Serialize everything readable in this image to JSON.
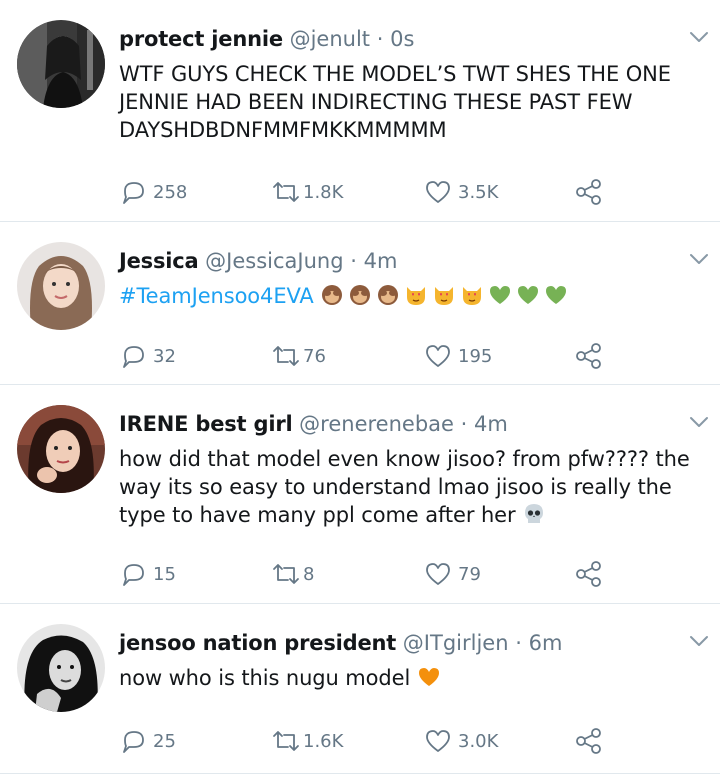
{
  "tweets": [
    {
      "name": "protect jennie",
      "handle": "@jenult",
      "dot": "·",
      "time": "0s",
      "text": "WTF GUYS CHECK THE MODEL’S TWT SHES THE ONE JENNIE HAD BEEN INDIRECTING THESE PAST FEW DAYSHDBDNFMMFMKKMMMMM",
      "replies": "258",
      "retweets": "1.8K",
      "likes": "3.5K"
    },
    {
      "name": "Jessica",
      "handle": "@JessicaJung",
      "dot": "·",
      "time": "4m",
      "hashtag": "#TeamJensoo4EVA",
      "emoji_icons": [
        "see-no-evil-monkey-icon",
        "see-no-evil-monkey-icon",
        "see-no-evil-monkey-icon",
        "heart-eyes-cat-icon",
        "heart-eyes-cat-icon",
        "heart-eyes-cat-icon",
        "green-heart-icon",
        "green-heart-icon",
        "green-heart-icon"
      ],
      "replies": "32",
      "retweets": "76",
      "likes": "195"
    },
    {
      "name": "IRENE best girl",
      "handle": "@renerenebae",
      "dot": "·",
      "time": "4m",
      "text": "how did that model even know jisoo? from pfw???? the way its so easy to understand lmao jisoo is really the type to have many ppl come after her",
      "emoji_icons": [
        "skull-icon"
      ],
      "replies": "15",
      "retweets": "8",
      "likes": "79"
    },
    {
      "name": "jensoo nation president",
      "handle": "@ITgirljen",
      "dot": "·",
      "time": "6m",
      "text": "now who is this nugu model",
      "emoji_icons": [
        "orange-heart-icon"
      ],
      "replies": "25",
      "retweets": "1.6K",
      "likes": "3.0K"
    }
  ],
  "colors": {
    "name": "#14171a",
    "secondary": "#657786",
    "hashtag": "#1da1f2",
    "divider": "#e1e8ed"
  }
}
